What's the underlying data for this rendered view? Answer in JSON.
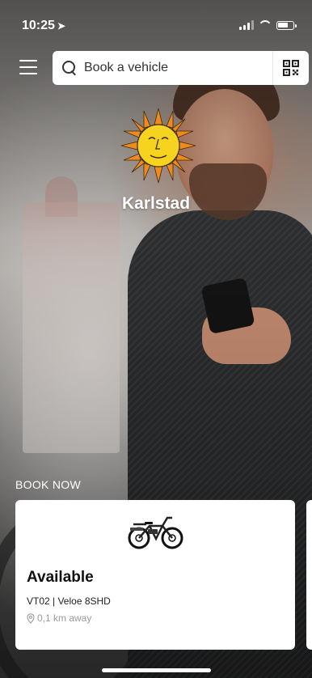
{
  "status_bar": {
    "time": "10:25",
    "location_icon": "location-arrow-icon",
    "signal_icon": "cellular-signal-icon",
    "wifi_icon": "wifi-icon",
    "battery_icon": "battery-icon"
  },
  "header": {
    "menu_icon": "hamburger-menu-icon",
    "search_placeholder": "Book a vehicle",
    "search_icon": "search-icon",
    "qr_icon": "qr-code-icon"
  },
  "city": {
    "name": "Karlstad",
    "logo_icon": "sun-face-icon"
  },
  "book_now": {
    "label": "BOOK NOW",
    "card": {
      "status": "Available",
      "model": "VT02 | Veloe 8SHD",
      "distance": "0,1 km away",
      "vehicle_icon": "bicycle-icon",
      "distance_icon": "map-pin-icon"
    }
  },
  "colors": {
    "sun_fill": "#f6d31e",
    "sun_rays": "#f08a1c",
    "card_bg": "#ffffff",
    "muted_text": "#9a9a9a"
  }
}
